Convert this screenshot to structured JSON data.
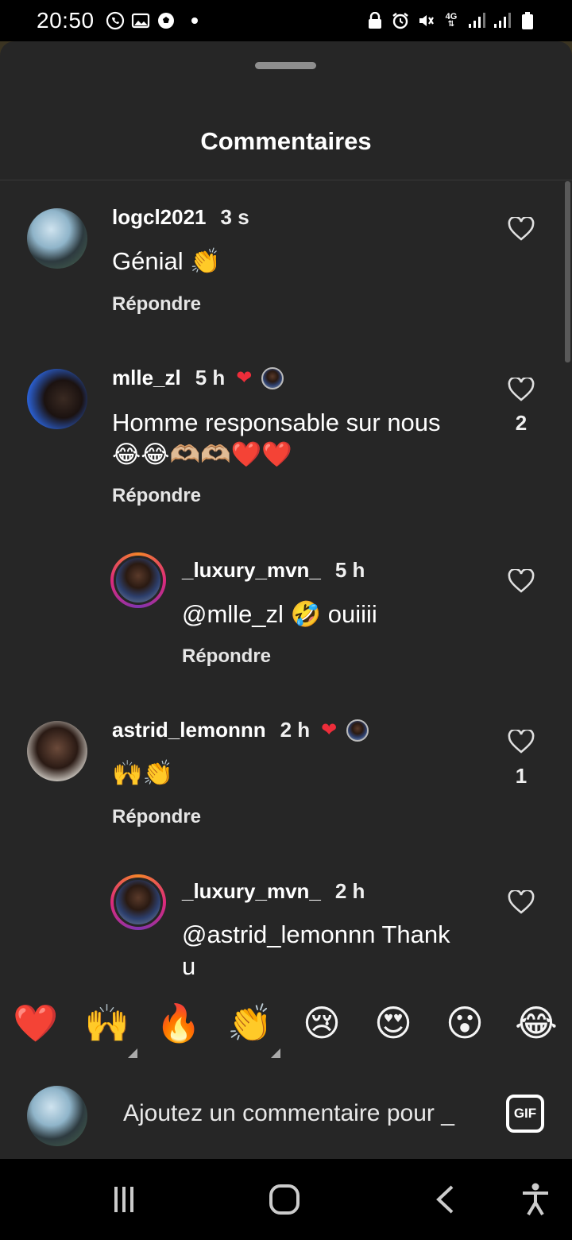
{
  "status_bar": {
    "time": "20:50",
    "left_icons": [
      "whatsapp-icon",
      "gallery-icon",
      "football-icon"
    ],
    "right_icons": [
      "lock-icon",
      "alarm-icon",
      "mute-icon",
      "network-4g-icon",
      "signal-icon",
      "signal-icon",
      "battery-icon"
    ],
    "network_label": "4G"
  },
  "sheet": {
    "title": "Commentaires"
  },
  "comments": [
    {
      "username": "logcl2021",
      "time": "3 s",
      "text": "Génial 👏",
      "reply_label": "Répondre",
      "like_count": "",
      "author_liked": false
    },
    {
      "username": "mlle_zl",
      "time": "5 h",
      "text_line1": "Homme responsable sur nous",
      "text_line2": "😂😂🫶🏼🫶🏼❤️❤️",
      "reply_label": "Répondre",
      "like_count": "2",
      "author_liked": true
    },
    {
      "username": "_luxury_mvn_",
      "time": "5 h",
      "text": "@mlle_zl 🤣 ouiiii",
      "reply_label": "Répondre",
      "like_count": "",
      "is_reply": true
    },
    {
      "username": "astrid_lemonnn",
      "time": "2 h",
      "text": "🙌👏",
      "reply_label": "Répondre",
      "like_count": "1",
      "author_liked": true
    },
    {
      "username": "_luxury_mvn_",
      "time": "2 h",
      "text_line1": "@astrid_lemonnn Thank",
      "text_line2": "u",
      "like_count": "",
      "is_reply": true
    }
  ],
  "emoji_bar": [
    "❤️",
    "🙌",
    "🔥",
    "👏",
    "😢",
    "😍",
    "😮",
    "😂"
  ],
  "composer": {
    "placeholder": "Ajoutez un commentaire pour _",
    "gif_label": "GIF"
  },
  "nav_bar": {
    "buttons": [
      "recents-icon",
      "home-icon",
      "back-icon",
      "accessibility-icon"
    ]
  }
}
